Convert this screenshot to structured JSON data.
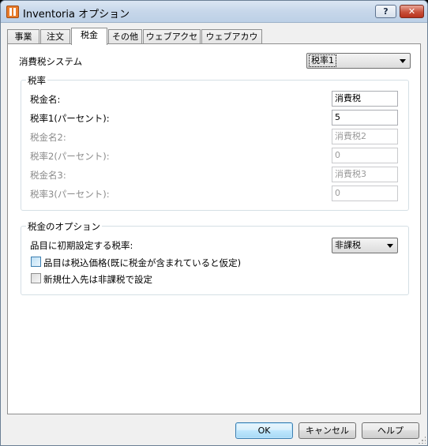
{
  "window": {
    "title": "Inventoria オプション",
    "help_label": "?",
    "close_label": "✕"
  },
  "tabs": [
    "事業",
    "注文",
    "税金",
    "その他",
    "ウェブアクセス",
    "ウェブアカウント"
  ],
  "active_tab": "税金",
  "tax_system": {
    "label": "消費税システム",
    "selected": "税率1"
  },
  "tax_rates": {
    "title": "税率",
    "rows": [
      {
        "label": "税金名:",
        "value": "消費税",
        "enabled": true
      },
      {
        "label": "税率1(パーセント):",
        "value": "5",
        "enabled": true
      },
      {
        "label": "税金名2:",
        "value": "消費税2",
        "enabled": false
      },
      {
        "label": "税率2(パーセント):",
        "value": "0",
        "enabled": false
      },
      {
        "label": "税金名3:",
        "value": "消費税3",
        "enabled": false
      },
      {
        "label": "税率3(パーセント):",
        "value": "0",
        "enabled": false
      }
    ]
  },
  "tax_options": {
    "title": "税金のオプション",
    "default_rate_label": "品目に初期設定する税率:",
    "default_rate_selected": "非課税",
    "tax_inclusive_label": "品目は税込価格(既に税金が含まれていると仮定)",
    "tax_inclusive_checked": false,
    "new_supplier_label": "新規仕入先は非課税で設定",
    "new_supplier_checked": false
  },
  "buttons": {
    "ok": "OK",
    "cancel": "キャンセル",
    "help": "ヘルプ"
  }
}
